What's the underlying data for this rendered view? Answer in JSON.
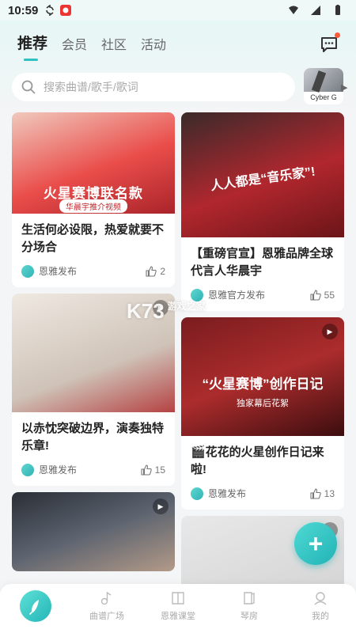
{
  "status_bar": {
    "time": "10:59"
  },
  "header": {
    "tabs": [
      {
        "label": "推荐",
        "active": true
      },
      {
        "label": "会员",
        "active": false
      },
      {
        "label": "社区",
        "active": false
      },
      {
        "label": "活动",
        "active": false
      }
    ]
  },
  "search": {
    "placeholder": "搜索曲谱/歌手/歌词"
  },
  "promo": {
    "label": "Cyber G"
  },
  "feed": {
    "left": [
      {
        "image_text": "火星赛博联名款",
        "image_sub": "华晨宇推介视频",
        "title": "生活何必设限，热爱就要不分场合",
        "author": "恩雅发布",
        "likes": "2"
      },
      {
        "title": "以赤忱突破边界，演奏独特乐章!",
        "author": "恩雅发布",
        "likes": "15"
      },
      {
        "title": ""
      }
    ],
    "right": [
      {
        "image_text": "人人都是“音乐家”!",
        "title": "【重磅官宣】恩雅品牌全球代言人华晨宇",
        "author": "恩雅官方发布",
        "likes": "55"
      },
      {
        "image_text": "“火星赛博”创作日记",
        "image_sub": "独家幕后花絮",
        "title": "🎬花花的火星创作日记来啦!",
        "author": "恩雅发布",
        "likes": "13"
      },
      {
        "title": ""
      }
    ]
  },
  "watermark": {
    "main": "K73",
    "small": "游戏之家"
  },
  "fab": {
    "label": "+"
  },
  "bottom_nav": {
    "items": [
      {
        "label": "曲谱广场"
      },
      {
        "label": "恩雅课堂"
      },
      {
        "label": "琴房"
      },
      {
        "label": "我的"
      }
    ]
  },
  "colors": {
    "accent": "#2fc1c1",
    "badge": "#ff5a3c"
  }
}
